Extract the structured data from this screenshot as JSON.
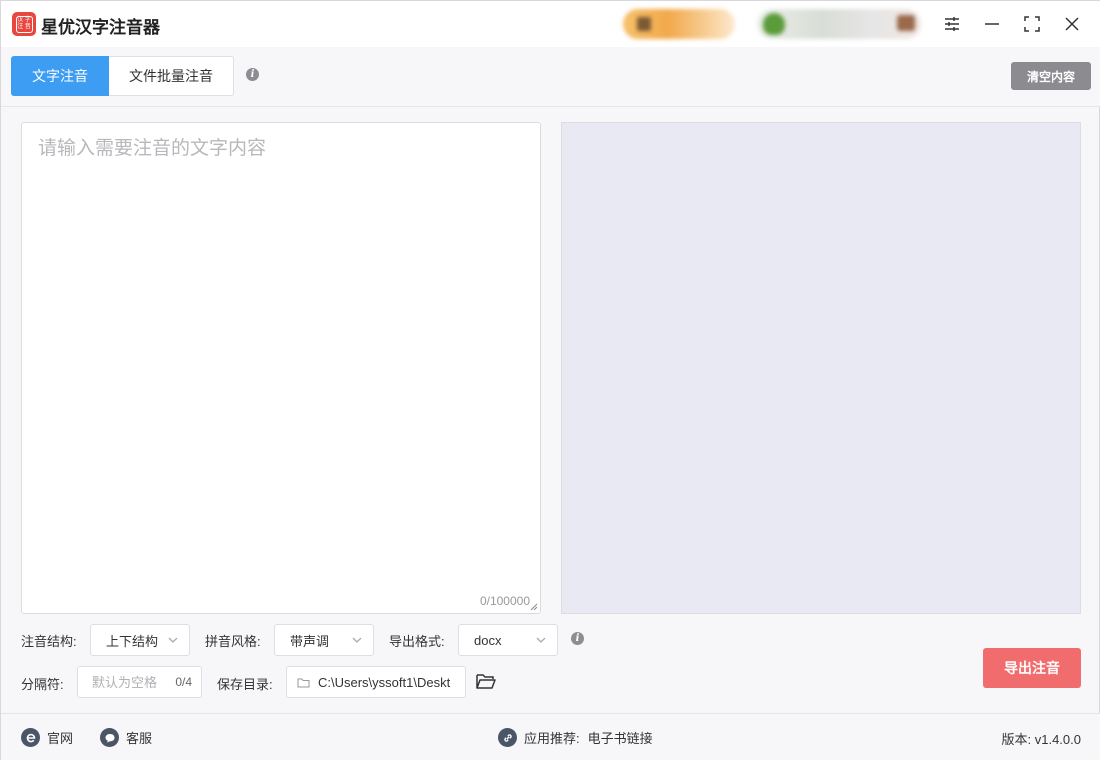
{
  "app": {
    "title": "星优汉字注音器",
    "logo_chars": [
      "汉",
      "字",
      "注",
      "音"
    ]
  },
  "tabs": [
    {
      "label": "文字注音",
      "active": true
    },
    {
      "label": "文件批量注音",
      "active": false
    }
  ],
  "toolbar": {
    "clear_label": "清空内容"
  },
  "editor": {
    "placeholder": "请输入需要注音的文字内容",
    "value": "",
    "char_count": "0/100000"
  },
  "options": {
    "structure_label": "注音结构:",
    "structure_value": "上下结构",
    "style_label": "拼音风格:",
    "style_value": "带声调",
    "format_label": "导出格式:",
    "format_value": "docx",
    "separator_label": "分隔符:",
    "separator_placeholder": "默认为空格",
    "separator_count": "0/4",
    "dir_label": "保存目录:",
    "dir_value": "C:\\Users\\yssoft1\\Deskt"
  },
  "actions": {
    "export_label": "导出注音"
  },
  "footer": {
    "website_label": "官网",
    "support_label": "客服",
    "recommend_prefix": "应用推荐:",
    "recommend_link": "电子书链接",
    "version": "版本: v1.4.0.0"
  },
  "colors": {
    "accent_blue": "#3d9df3",
    "export_red": "#f16c6c",
    "clear_gray": "#8b8b90",
    "output_bg": "#e9e9f3"
  }
}
